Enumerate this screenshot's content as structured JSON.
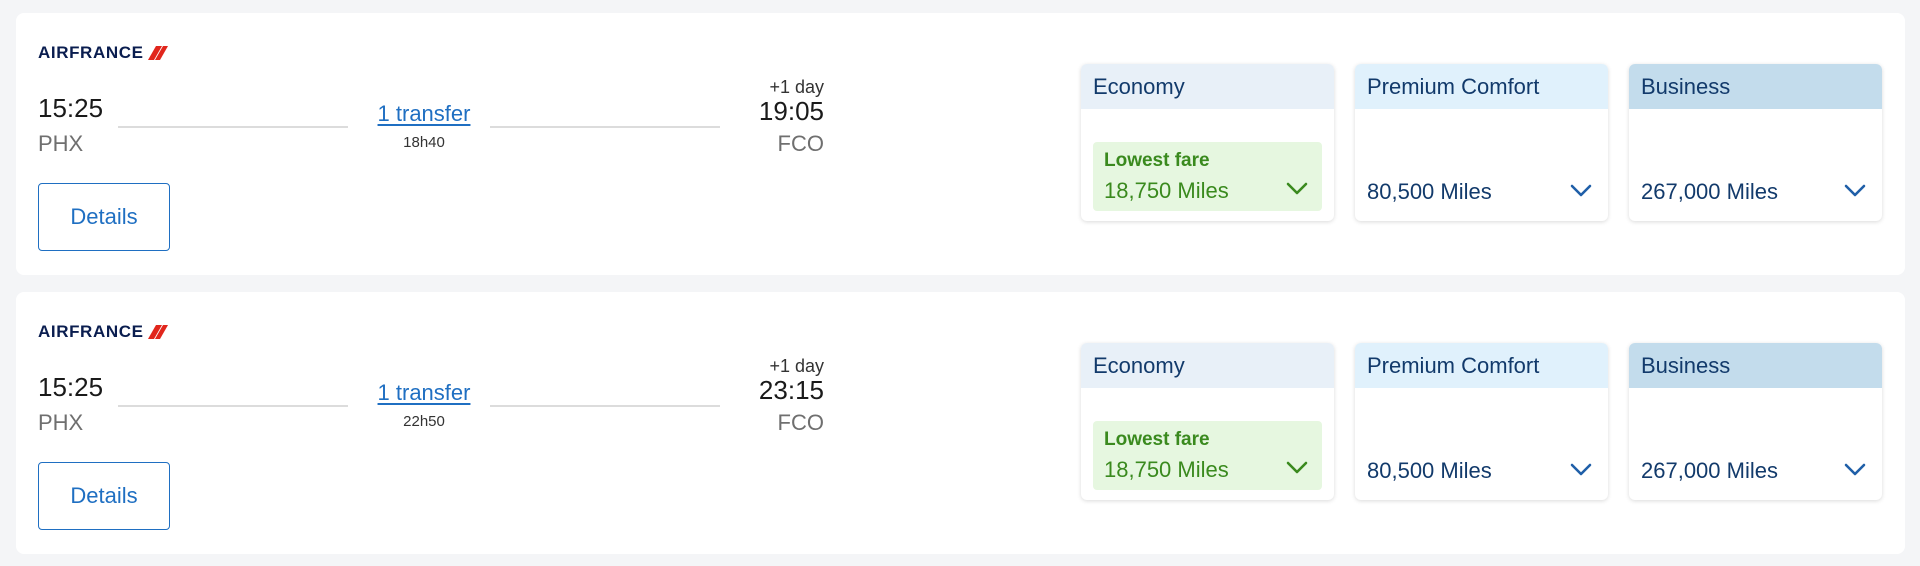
{
  "colors": {
    "accent": "#1f6fc2",
    "lowest_fare_green": "#3a8a1e",
    "lowest_fare_bg": "#e6f7e0",
    "brand_red": "#e1261c",
    "brand_navy": "#0a1d4f"
  },
  "flights": [
    {
      "airline_logo": "AIRFRANCE",
      "departure_time": "15:25",
      "departure_code": "PHX",
      "transfer_label": "1 transfer",
      "duration": "18h40",
      "day_offset": "+1 day",
      "arrival_time": "19:05",
      "arrival_code": "FCO",
      "details_label": "Details",
      "fares": {
        "economy": {
          "title": "Economy",
          "badge": "Lowest fare",
          "price": "18,750 Miles",
          "icon": "chevron-down-icon"
        },
        "premium": {
          "title": "Premium Comfort",
          "price": "80,500 Miles",
          "icon": "chevron-down-icon"
        },
        "business": {
          "title": "Business",
          "price": "267,000 Miles",
          "icon": "chevron-down-icon"
        }
      }
    },
    {
      "airline_logo": "AIRFRANCE",
      "departure_time": "15:25",
      "departure_code": "PHX",
      "transfer_label": "1 transfer",
      "duration": "22h50",
      "day_offset": "+1 day",
      "arrival_time": "23:15",
      "arrival_code": "FCO",
      "details_label": "Details",
      "fares": {
        "economy": {
          "title": "Economy",
          "badge": "Lowest fare",
          "price": "18,750 Miles",
          "icon": "chevron-down-icon"
        },
        "premium": {
          "title": "Premium Comfort",
          "price": "80,500 Miles",
          "icon": "chevron-down-icon"
        },
        "business": {
          "title": "Business",
          "price": "267,000 Miles",
          "icon": "chevron-down-icon"
        }
      }
    }
  ]
}
